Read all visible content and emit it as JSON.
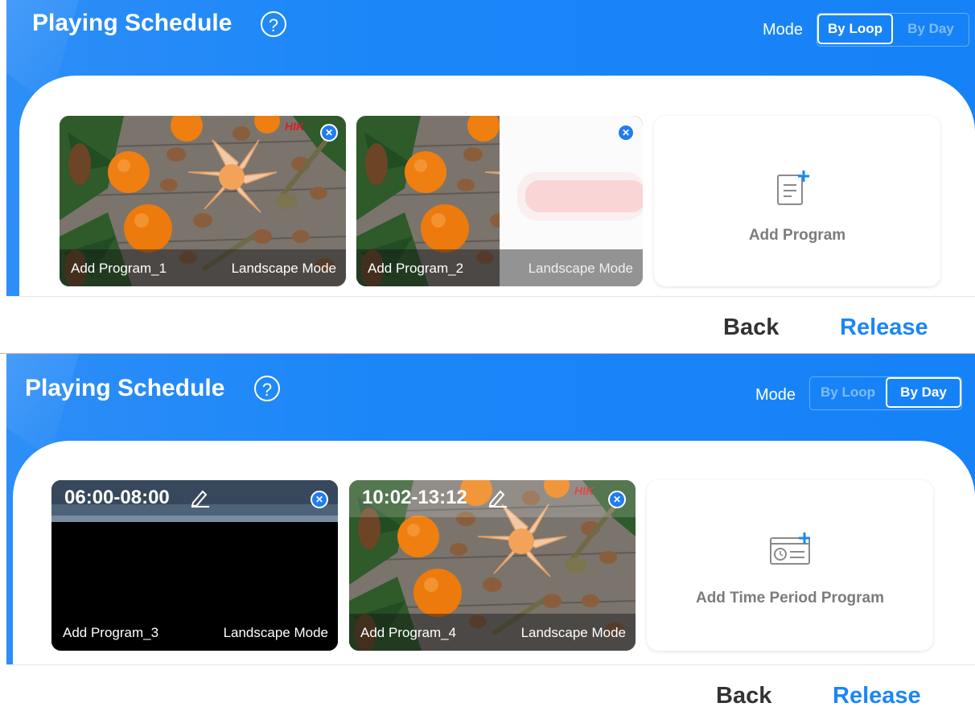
{
  "screens": [
    {
      "title": "Playing Schedule",
      "help_icon": "?",
      "mode_label": "Mode",
      "mode_options": [
        "By Loop",
        "By Day"
      ],
      "selected_mode": "By Loop",
      "programs": [
        {
          "name": "Add Program_1",
          "orientation": "Landscape Mode"
        },
        {
          "name": "Add Program_2",
          "orientation": "Landscape Mode"
        }
      ],
      "add_label": "Add Program",
      "back_label": "Back",
      "release_label": "Release"
    },
    {
      "title": "Playing Schedule",
      "help_icon": "?",
      "mode_label": "Mode",
      "mode_options": [
        "By Loop",
        "By Day"
      ],
      "selected_mode": "By Day",
      "programs": [
        {
          "time": "06:00-08:00",
          "name": "Add Program_3",
          "orientation": "Landscape Mode"
        },
        {
          "time": "10:02-13:12",
          "name": "Add Program_4",
          "orientation": "Landscape Mode"
        }
      ],
      "add_label": "Add Time Period Program",
      "back_label": "Back",
      "release_label": "Release"
    }
  ],
  "colors": {
    "accent": "#1a86f8",
    "close_badge": "#1f7cf2"
  },
  "icons": [
    "help-icon",
    "close-icon",
    "pencil-icon",
    "add-program-icon",
    "add-time-period-icon"
  ]
}
